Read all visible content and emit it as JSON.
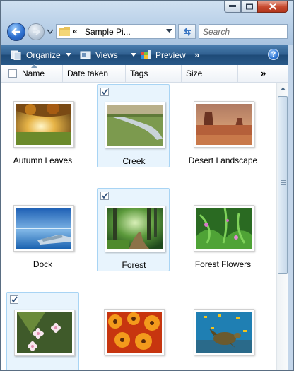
{
  "window": {
    "address_chevron": "«",
    "address_text": "Sample Pi...",
    "search_placeholder": "Search"
  },
  "toolbar": {
    "organize_label": "Organize",
    "views_label": "Views",
    "preview_label": "Preview",
    "more_label": "»",
    "help_label": "?"
  },
  "columns": {
    "name": "Name",
    "date_taken": "Date taken",
    "tags": "Tags",
    "size": "Size",
    "more": "»"
  },
  "items": [
    {
      "name": "Autumn Leaves",
      "selected": false,
      "icon": "autumn-leaves-thumbnail"
    },
    {
      "name": "Creek",
      "selected": true,
      "icon": "creek-thumbnail"
    },
    {
      "name": "Desert Landscape",
      "selected": false,
      "icon": "desert-landscape-thumbnail"
    },
    {
      "name": "Dock",
      "selected": false,
      "icon": "dock-thumbnail"
    },
    {
      "name": "Forest",
      "selected": true,
      "icon": "forest-thumbnail"
    },
    {
      "name": "Forest Flowers",
      "selected": false,
      "icon": "forest-flowers-thumbnail"
    },
    {
      "name": "",
      "selected": true,
      "icon": "frangipani-flowers-thumbnail"
    },
    {
      "name": "",
      "selected": false,
      "icon": "garden-flowers-thumbnail"
    },
    {
      "name": "",
      "selected": false,
      "icon": "green-sea-turtle-thumbnail"
    }
  ],
  "colors": {
    "command_bar": "#2f5f8f",
    "selection_fill": "#e8f4fd",
    "selection_border": "#a8d4f4"
  }
}
